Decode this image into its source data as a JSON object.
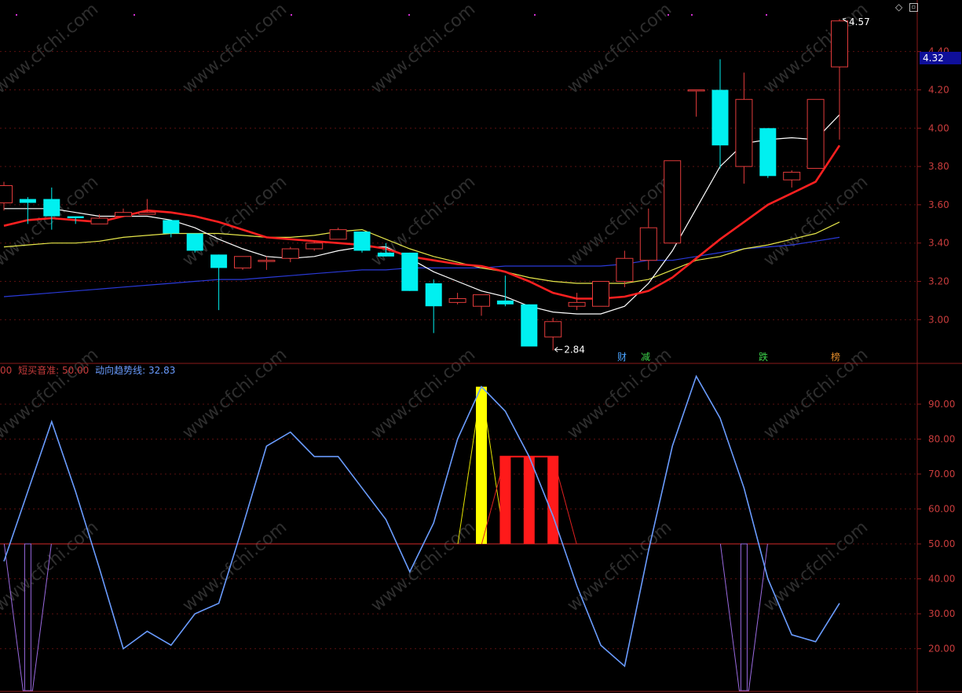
{
  "toolbar": {
    "diamond_icon": "diamond-icon",
    "window_icon": "window-restore-icon"
  },
  "main_panel": {
    "last_price_tag": "4.32",
    "y_axis": {
      "ticks": [
        "4.40",
        "4.20",
        "4.00",
        "3.80",
        "3.60",
        "3.40",
        "3.20",
        "3.00"
      ]
    },
    "high_annotation": "4.57",
    "low_annotation": "2.84",
    "events": [
      {
        "label": "财",
        "color": "#4aa3ff"
      },
      {
        "label": "减",
        "color": "#3cd24a"
      },
      {
        "label": "跌",
        "color": "#3cd24a"
      },
      {
        "label": "榜",
        "color": "#e08a2a"
      }
    ]
  },
  "indicator_panel": {
    "header_items": [
      {
        "text": "00",
        "color": "#c83c3c"
      },
      {
        "text": "短买音准: 50.00",
        "color": "#c83c3c"
      },
      {
        "text": "动向趋势线: 32.83",
        "color": "#6a9cff"
      }
    ],
    "y_axis": {
      "ticks": [
        "90.00",
        "80.00",
        "70.00",
        "60.00",
        "50.00",
        "40.00",
        "30.00",
        "20.00"
      ]
    }
  },
  "colors": {
    "up": "#e23b3b",
    "down": "#00f0f0",
    "ma5": "#ffffff",
    "ma10": "#ff2020",
    "ma20": "#e6e64a",
    "ma60": "#2a3ad8",
    "trend": "#6a9cff",
    "axis": "#8b1a1a",
    "grid": "#5a1010"
  },
  "watermark": "www.cfchi.com",
  "chart_data": [
    {
      "type": "candlestick",
      "ylim": [
        2.78,
        4.62
      ],
      "candles": [
        {
          "o": 3.61,
          "h": 3.72,
          "l": 3.57,
          "c": 3.7
        },
        {
          "o": 3.63,
          "h": 3.64,
          "l": 3.5,
          "c": 3.61
        },
        {
          "o": 3.63,
          "h": 3.69,
          "l": 3.47,
          "c": 3.54
        },
        {
          "o": 3.54,
          "h": 3.54,
          "l": 3.5,
          "c": 3.53
        },
        {
          "o": 3.5,
          "h": 3.55,
          "l": 3.5,
          "c": 3.53
        },
        {
          "o": 3.54,
          "h": 3.58,
          "l": 3.54,
          "c": 3.56
        },
        {
          "o": 3.55,
          "h": 3.63,
          "l": 3.55,
          "c": 3.56
        },
        {
          "o": 3.52,
          "h": 3.52,
          "l": 3.43,
          "c": 3.45
        },
        {
          "o": 3.45,
          "h": 3.45,
          "l": 3.35,
          "c": 3.36
        },
        {
          "o": 3.34,
          "h": 3.34,
          "l": 3.05,
          "c": 3.27
        },
        {
          "o": 3.27,
          "h": 3.33,
          "l": 3.26,
          "c": 3.33
        },
        {
          "o": 3.31,
          "h": 3.33,
          "l": 3.26,
          "c": 3.31
        },
        {
          "o": 3.32,
          "h": 3.38,
          "l": 3.3,
          "c": 3.37
        },
        {
          "o": 3.37,
          "h": 3.41,
          "l": 3.36,
          "c": 3.4
        },
        {
          "o": 3.42,
          "h": 3.48,
          "l": 3.42,
          "c": 3.47
        },
        {
          "o": 3.46,
          "h": 3.46,
          "l": 3.35,
          "c": 3.36
        },
        {
          "o": 3.35,
          "h": 3.4,
          "l": 3.33,
          "c": 3.33
        },
        {
          "o": 3.35,
          "h": 3.35,
          "l": 3.15,
          "c": 3.15
        },
        {
          "o": 3.19,
          "h": 3.21,
          "l": 2.93,
          "c": 3.07
        },
        {
          "o": 3.09,
          "h": 3.14,
          "l": 3.08,
          "c": 3.11
        },
        {
          "o": 3.07,
          "h": 3.12,
          "l": 3.02,
          "c": 3.13
        },
        {
          "o": 3.1,
          "h": 3.23,
          "l": 3.07,
          "c": 3.08
        },
        {
          "o": 3.08,
          "h": 3.08,
          "l": 2.86,
          "c": 2.86
        },
        {
          "o": 2.91,
          "h": 3.01,
          "l": 2.84,
          "c": 2.99
        },
        {
          "o": 3.07,
          "h": 3.14,
          "l": 3.05,
          "c": 3.09
        },
        {
          "o": 3.07,
          "h": 3.2,
          "l": 3.07,
          "c": 3.2
        },
        {
          "o": 3.2,
          "h": 3.36,
          "l": 3.17,
          "c": 3.32
        },
        {
          "o": 3.31,
          "h": 3.58,
          "l": 3.26,
          "c": 3.48
        },
        {
          "o": 3.4,
          "h": 3.83,
          "l": 3.4,
          "c": 3.83
        },
        {
          "o": 4.2,
          "h": 4.2,
          "l": 4.06,
          "c": 4.2
        },
        {
          "o": 4.2,
          "h": 4.36,
          "l": 3.79,
          "c": 3.91
        },
        {
          "o": 3.8,
          "h": 4.29,
          "l": 3.71,
          "c": 4.15
        },
        {
          "o": 4.0,
          "h": 4.0,
          "l": 3.74,
          "c": 3.75
        },
        {
          "o": 3.73,
          "h": 3.78,
          "l": 3.69,
          "c": 3.77
        },
        {
          "o": 3.79,
          "h": 4.15,
          "l": 3.79,
          "c": 4.15
        },
        {
          "o": 4.32,
          "h": 4.57,
          "l": 3.94,
          "c": 4.56
        }
      ],
      "ma5": [
        3.58,
        3.58,
        3.58,
        3.56,
        3.54,
        3.54,
        3.54,
        3.52,
        3.48,
        3.42,
        3.37,
        3.33,
        3.32,
        3.33,
        3.36,
        3.38,
        3.38,
        3.32,
        3.25,
        3.2,
        3.15,
        3.12,
        3.07,
        3.04,
        3.03,
        3.03,
        3.07,
        3.19,
        3.36,
        3.58,
        3.8,
        3.92,
        3.94,
        3.95,
        3.94,
        4.07
      ],
      "ma10": [
        3.49,
        3.52,
        3.53,
        3.52,
        3.51,
        3.54,
        3.57,
        3.56,
        3.54,
        3.51,
        3.47,
        3.43,
        3.42,
        3.41,
        3.4,
        3.39,
        3.37,
        3.33,
        3.31,
        3.29,
        3.28,
        3.25,
        3.2,
        3.14,
        3.11,
        3.11,
        3.12,
        3.15,
        3.22,
        3.32,
        3.42,
        3.51,
        3.6,
        3.66,
        3.72,
        3.91
      ],
      "ma20": [
        3.38,
        3.39,
        3.4,
        3.4,
        3.41,
        3.43,
        3.44,
        3.45,
        3.45,
        3.45,
        3.44,
        3.43,
        3.43,
        3.44,
        3.46,
        3.47,
        3.42,
        3.37,
        3.33,
        3.3,
        3.27,
        3.25,
        3.22,
        3.2,
        3.19,
        3.19,
        3.19,
        3.21,
        3.26,
        3.31,
        3.33,
        3.37,
        3.39,
        3.42,
        3.45,
        3.51
      ],
      "ma60": [
        3.12,
        3.13,
        3.14,
        3.15,
        3.16,
        3.17,
        3.18,
        3.19,
        3.2,
        3.21,
        3.21,
        3.22,
        3.23,
        3.24,
        3.25,
        3.26,
        3.26,
        3.27,
        3.27,
        3.27,
        3.27,
        3.28,
        3.28,
        3.28,
        3.28,
        3.28,
        3.29,
        3.31,
        3.31,
        3.33,
        3.35,
        3.37,
        3.38,
        3.39,
        3.41,
        3.43
      ]
    },
    {
      "type": "line",
      "ylim": [
        8,
        101
      ],
      "baseline": 50,
      "trend": [
        45,
        65,
        85,
        65,
        43,
        20,
        25,
        21,
        30,
        33,
        55,
        78,
        82,
        75,
        75,
        66,
        57,
        42,
        56,
        80,
        95,
        88,
        75,
        58,
        38,
        21,
        15,
        48,
        78,
        98,
        86,
        66,
        40,
        24,
        22,
        33
      ],
      "yellow_bar": {
        "index": 20,
        "value": 95
      },
      "red_bars": [
        {
          "index": 21,
          "value": 75
        },
        {
          "index": 22,
          "value": 75
        },
        {
          "index": 23,
          "value": 75
        }
      ],
      "purple_spikes": [
        {
          "index": 1,
          "value": 8
        },
        {
          "index": 31,
          "value": 8
        }
      ]
    }
  ]
}
